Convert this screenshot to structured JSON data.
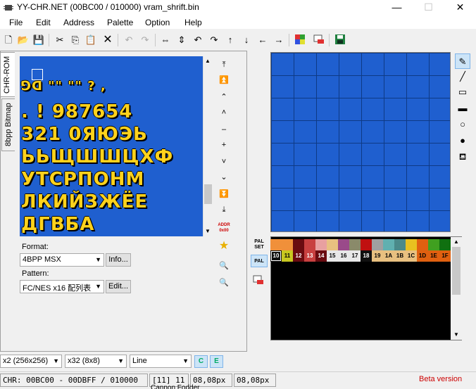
{
  "window": {
    "title": "YY-CHR.NET (00BC00 / 010000) vram_shrift.bin",
    "minimize": "—",
    "maximize": "☐",
    "close": "✕"
  },
  "menu": [
    "File",
    "Edit",
    "Address",
    "Palette",
    "Option",
    "Help"
  ],
  "tabs": {
    "chr_rom": "CHR-ROM",
    "bitmap": "8bpp Bitmap"
  },
  "chr_rows": [
    "  ⅁ᗡ  \"\" \"\" ?  ,",
    ". !  987654",
    "321 0ЯЮЭЬ",
    "ЬЬЩШШЦХФ",
    "УТСРПОНМ",
    "ЛКИЙЗЖЁЕ",
    "ДГВБА"
  ],
  "format": {
    "label": "Format:",
    "value": "4BPP MSX",
    "info_button": "Info..."
  },
  "pattern": {
    "label": "Pattern:",
    "value": "FC/NES x16 配列表",
    "edit_button": "Edit..."
  },
  "nav": {
    "addr_label": "ADDR 0x00"
  },
  "palette": {
    "set_label": "PAL SET",
    "pal_label": "PAL",
    "colors": [
      "#f0903a",
      "#f0903a",
      "#6a0b10",
      "#c84040",
      "#e8a0a0",
      "#e8c080",
      "#9a4a8a",
      "#8a8a6a",
      "#c01010",
      "#a0a0a0",
      "#60b0b0",
      "#4a8a8a",
      "#e8c020",
      "#e06010",
      "#40a020",
      "#107010"
    ],
    "labels": [
      "10",
      "11",
      "12",
      "13",
      "14",
      "15",
      "16",
      "17",
      "18",
      "19",
      "1A",
      "1B",
      "1C",
      "1D",
      "1E",
      "1F"
    ],
    "label_bg": [
      "#101010",
      "#c8c820",
      "#6a0b10",
      "#c84040",
      "#6a0b10",
      "#e8e8e8",
      "#e8e8e8",
      "#e8e8e8",
      "#101010",
      "#e8c080",
      "#e8c080",
      "#e8c080",
      "#e8c080",
      "#e06010",
      "#e06010",
      "#e06010"
    ]
  },
  "bottom": {
    "zoom": "x2 (256x256)",
    "grid": "x32 (8x8)",
    "tool": "Line"
  },
  "status": {
    "chr": "CHR: 00BC00 - 00DBFF / 010000",
    "index": "[11] 11",
    "pos1": "08,08px",
    "pos2": "08,08px",
    "beta": "Beta version",
    "behind_text": "Cannon Fodder"
  }
}
